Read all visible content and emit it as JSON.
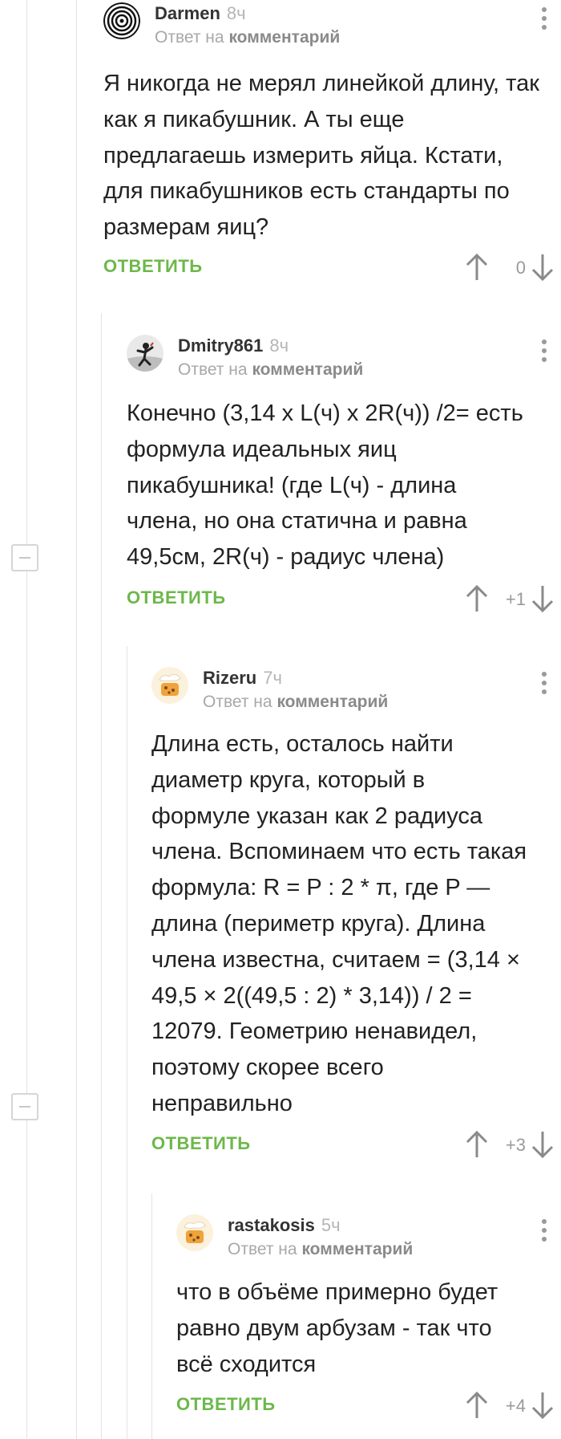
{
  "reply_prefix": "Ответ на",
  "reply_target": "комментарий",
  "reply_button": "ОТВЕТИТЬ",
  "colors": {
    "accent": "#6cb84a",
    "muted": "#a8a8a8"
  },
  "comments": [
    {
      "author": "Darmen",
      "time": "8ч",
      "avatar_icon": "spiral-avatar",
      "text": "Я никогда не мерял линейкой длину, так как я пикабушник. А ты еще предлагаешь измерить яйца. Кстати, для пикабушников есть стандарты по размерам яиц?",
      "score": "0"
    },
    {
      "author": "Dmitry861",
      "time": "8ч",
      "avatar_icon": "person-silhouette-avatar",
      "text": "Конечно (3,14 x L(ч) x 2R(ч)) /2= есть формула идеальных яиц пикабушника! (где L(ч) - длина члена, но она статична и равна 49,5см, 2R(ч) - радиус члена)",
      "score": "+1"
    },
    {
      "author": "Rizeru",
      "time": "7ч",
      "avatar_icon": "cookie-avatar",
      "text": "Длина есть, осталось найти диаметр круга, который в формуле указан как 2 радиуса члена. Вспоминаем что есть такая формула: R = P : 2 * π, где P — длина (периметр круга). Длина члена известна, считаем = (3,14 × 49,5 × 2((49,5 : 2) * 3,14)) / 2 = 12079. Геометрию ненавидел, поэтому скорее всего неправильно",
      "score": "+3"
    },
    {
      "author": "rastakosis",
      "time": "5ч",
      "avatar_icon": "cookie-avatar",
      "text": "что в объёме примерно будет равно двум арбузам - так что всё сходится",
      "score": "+4"
    }
  ]
}
